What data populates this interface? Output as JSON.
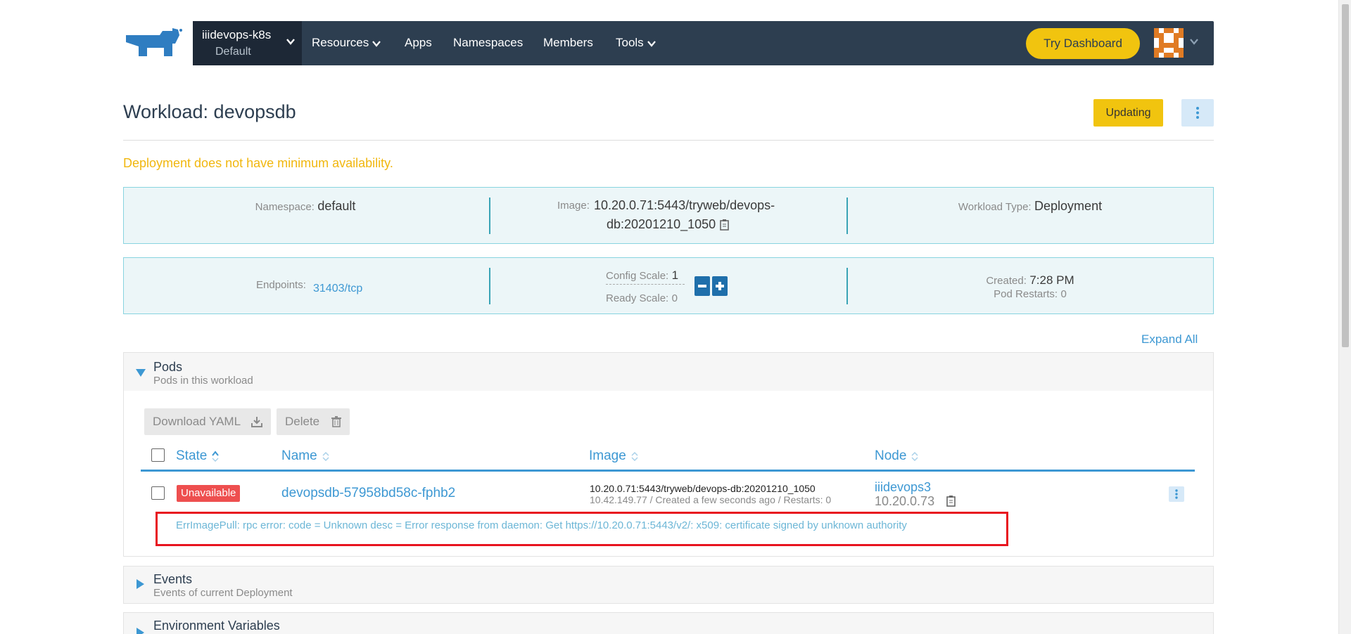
{
  "brand": {
    "logo": "rancher-logo-icon"
  },
  "navbar": {
    "cluster_name": "iiidevops-k8s",
    "project_name": "Default",
    "items": [
      "Resources",
      "Apps",
      "Namespaces",
      "Members",
      "Tools"
    ],
    "try_dashboard": "Try Dashboard"
  },
  "workload": {
    "title": "Workload: devopsdb",
    "status": "Updating",
    "warning": "Deployment does not have minimum availability."
  },
  "details": {
    "namespace_label": "Namespace:",
    "namespace_value": "default",
    "image_label": "Image:",
    "image_line1": "10.20.0.71:5443/tryweb/devops-",
    "image_line2": "db:20201210_1050",
    "type_label": "Workload Type:",
    "type_value": "Deployment",
    "endpoints_label": "Endpoints:",
    "endpoints_value": "31403/tcp",
    "config_scale_label": "Config Scale:",
    "config_scale_value": "1",
    "ready_scale_label": "Ready Scale:",
    "ready_scale_value": "0",
    "created_label": "Created:",
    "created_value": "7:28 PM",
    "restarts_label": "Pod Restarts:",
    "restarts_value": "0"
  },
  "expand_all": "Expand All",
  "pods": {
    "title": "Pods",
    "subtitle": "Pods in this workload",
    "download_yaml": "Download YAML",
    "delete": "Delete",
    "columns": {
      "state": "State",
      "name": "Name",
      "image": "Image",
      "node": "Node"
    },
    "rows": [
      {
        "state": "Unavailable",
        "name": "devopsdb-57958bd58c-fphb2",
        "image": "10.20.0.71:5443/tryweb/devops-db:20201210_1050",
        "meta": "10.42.149.77 / Created a few seconds ago / Restarts: 0",
        "node_name": "iiidevops3",
        "node_ip": "10.20.0.73",
        "error": "ErrImagePull: rpc error: code = Unknown desc = Error response from daemon: Get https://10.20.0.71:5443/v2/: x509: certificate signed by unknown authority"
      }
    ]
  },
  "events": {
    "title": "Events",
    "subtitle": "Events of current Deployment"
  },
  "env": {
    "title": "Environment Variables"
  },
  "colors": {
    "navbar": "#2d3e50",
    "accent": "#3d98d3",
    "warning": "#f1c40f",
    "error": "#ee4f4f"
  }
}
